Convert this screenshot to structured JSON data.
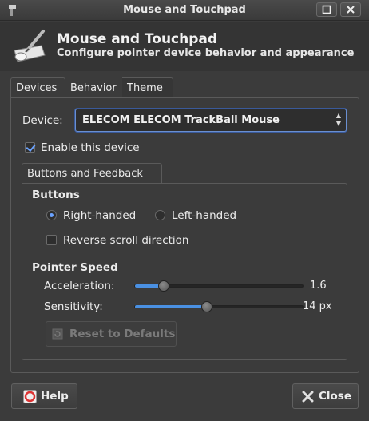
{
  "window": {
    "title": "Mouse and Touchpad"
  },
  "header": {
    "title": "Mouse and Touchpad",
    "subtitle": "Configure pointer device behavior and appearance",
    "icon": "mouse-tablet-icon"
  },
  "tabs": [
    {
      "label": "Devices",
      "active": true
    },
    {
      "label": "Behavior",
      "active": false
    },
    {
      "label": "Theme",
      "active": false
    }
  ],
  "device": {
    "label": "Device:",
    "selected": "ELECOM ELECOM TrackBall Mouse"
  },
  "enable_device": {
    "label": "Enable this device",
    "checked": true
  },
  "subtab": {
    "label": "Buttons and Feedback"
  },
  "buttons_section": {
    "title": "Buttons",
    "right_handed": {
      "label": "Right-handed",
      "selected": true
    },
    "left_handed": {
      "label": "Left-handed",
      "selected": false
    },
    "reverse_scroll": {
      "label": "Reverse scroll direction",
      "checked": false
    }
  },
  "pointer_speed": {
    "title": "Pointer Speed",
    "acceleration": {
      "label": "Acceleration:",
      "value": "1.6",
      "fraction": 0.17
    },
    "sensitivity": {
      "label": "Sensitivity:",
      "value": "14 px",
      "fraction": 0.43
    }
  },
  "actions": {
    "reset": "Reset to Defaults",
    "help": "Help",
    "close": "Close"
  },
  "colors": {
    "accent": "#4a90e2",
    "background": "#3b3b3b"
  }
}
